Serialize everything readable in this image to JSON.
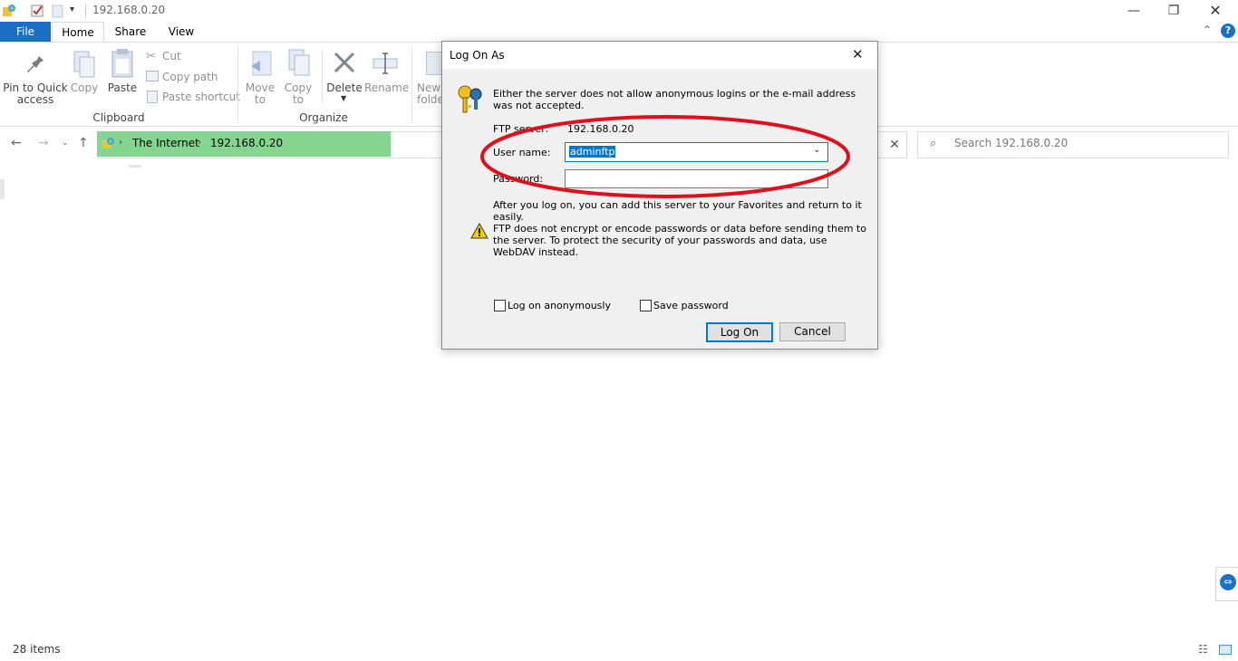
{
  "window": {
    "title": "192.168.0.20"
  },
  "tabs": [
    {
      "label": "File"
    },
    {
      "label": "Home"
    },
    {
      "label": "Share"
    },
    {
      "label": "View"
    }
  ],
  "ribbon": {
    "clipboard": {
      "pin_l1": "Pin to Quick",
      "pin_l2": "access",
      "copy": "Copy",
      "paste": "Paste",
      "cut": "Cut",
      "copy_path": "Copy path",
      "paste_shortcut": "Paste shortcut",
      "group": "Clipboard"
    },
    "organize": {
      "move_l1": "Move",
      "move_l2": "to",
      "copy_l1": "Copy",
      "copy_l2": "to",
      "delete": "Delete",
      "rename": "Rename",
      "group": "Organize"
    },
    "new": {
      "new_l1": "New",
      "new_l2": "folder"
    }
  },
  "address": {
    "crumbs": [
      {
        "label": "The Internet"
      },
      {
        "label": "192.168.0.20"
      }
    ],
    "search_placeholder": "Search 192.168.0.20"
  },
  "dialog": {
    "title": "Log On As",
    "message": "Either the server does not allow anonymous logins or the e-mail address was not accepted.",
    "ftp_server_label": "FTP server:",
    "ftp_server_value": "192.168.0.20",
    "username_label": "User name:",
    "username_value": "adminftp",
    "password_label": "Password:",
    "password_value": "",
    "favorites_note": "After you log on, you can add this server to your Favorites and return to it easily.",
    "warning": "FTP does not encrypt or encode passwords or data before sending them to the server.  To protect the security of your passwords and data, use WebDAV instead.",
    "anon_label": "Log on anonymously",
    "save_label": "Save password",
    "logon_button": "Log On",
    "cancel_button": "Cancel"
  },
  "status": {
    "items": "28 items"
  },
  "colors": {
    "file_tab": "#1a6fc4",
    "address_fill": "#83d58f",
    "annotation": "#e0101a"
  }
}
